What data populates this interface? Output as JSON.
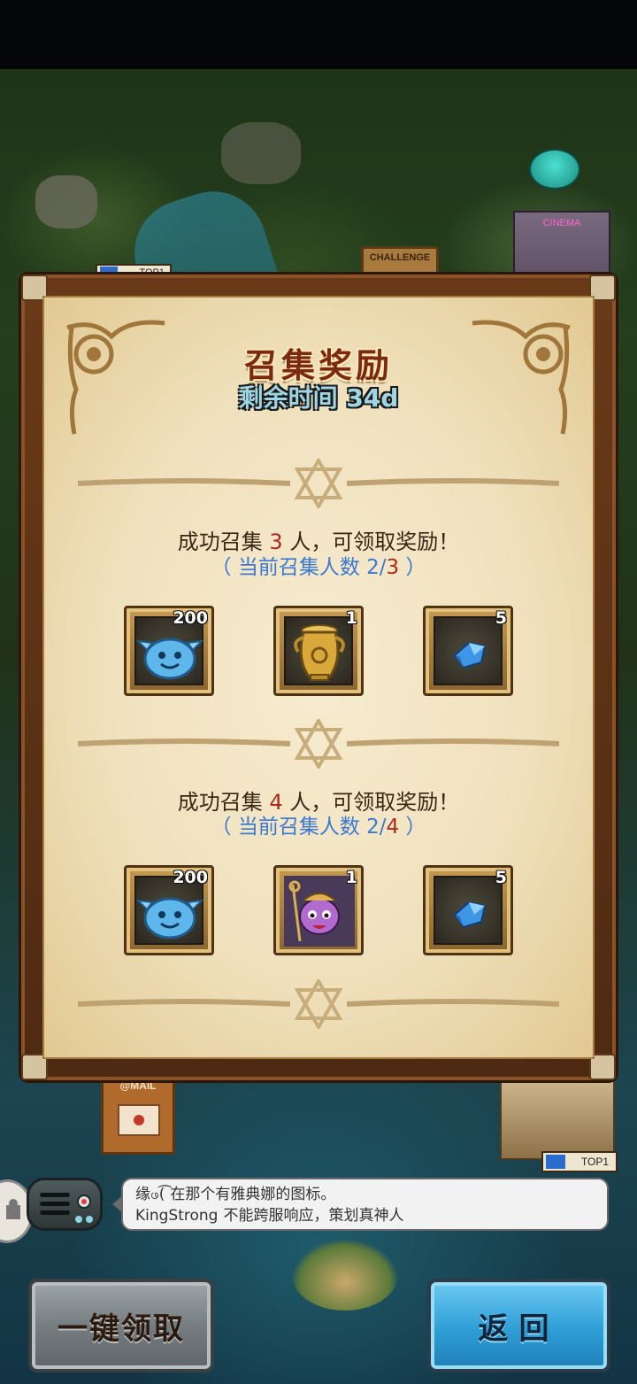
{
  "map": {
    "challenge_label": "CHALLENGE",
    "cinema_label": "CINEMA",
    "mail_label": "@MAIL",
    "top1_label": "TOP1"
  },
  "panel": {
    "title": "召集奖励",
    "time_label": "剩余时间",
    "time_value": "34d",
    "sections": [
      {
        "head_prefix": "成功召集",
        "required": "3",
        "head_suffix": "人，可领取奖励！",
        "progress_prefix": "（ 当前召集人数",
        "current": "2/",
        "progress_suffix": "）",
        "rewards": [
          {
            "icon": "blue-slime-icon",
            "count": "200"
          },
          {
            "icon": "golden-urn-icon",
            "count": "1"
          },
          {
            "icon": "blue-crystal-icon",
            "count": "5"
          }
        ]
      },
      {
        "head_prefix": "成功召集",
        "required": "4",
        "head_suffix": "人，可领取奖励！",
        "progress_prefix": "（ 当前召集人数",
        "current": "2/",
        "progress_suffix": "）",
        "rewards": [
          {
            "icon": "blue-slime-icon",
            "count": "200"
          },
          {
            "icon": "purple-hero-portrait-icon",
            "count": "1"
          },
          {
            "icon": "blue-crystal-icon",
            "count": "5"
          }
        ]
      }
    ]
  },
  "chat": {
    "messages": [
      {
        "sender": "缘ဖ(͡",
        "text": "在那个有雅典娜的图标。"
      },
      {
        "sender": "KingStrong",
        "text": "不能跨服响应，策划真神人"
      }
    ]
  },
  "buttons": {
    "claim_all": "一键领取",
    "back": "返回"
  },
  "colors": {
    "title": "#7b2a10",
    "highlight_number": "#b0281a",
    "progress_text": "#3a79d4",
    "back_button": "#2f9ed6",
    "claim_button": "#767d80"
  }
}
